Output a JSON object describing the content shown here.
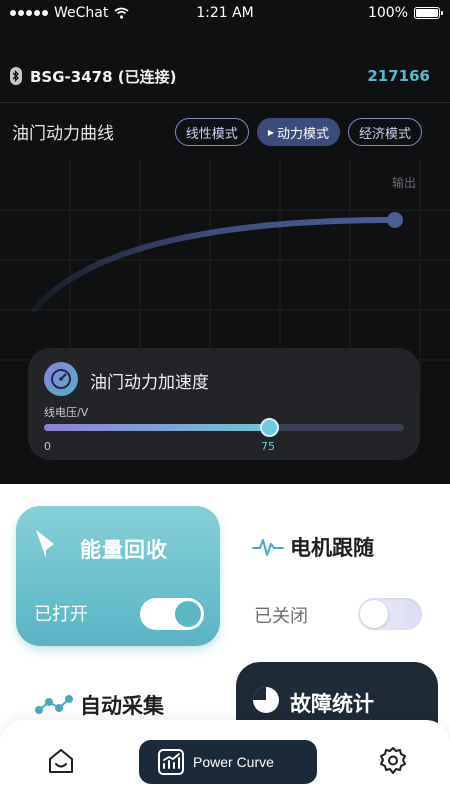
{
  "status_bar": {
    "carrier": "WeChat",
    "time": "1:21 AM",
    "battery": "100%"
  },
  "device": {
    "name": "BSG-3478 (已连接)",
    "code": "217166"
  },
  "curve": {
    "title": "油门动力曲线",
    "modes": [
      "线性模式",
      "动力模式",
      "经济模式"
    ],
    "active_mode": "动力模式",
    "output_label": "输出"
  },
  "acceleration": {
    "title": "油门动力加速度",
    "axis_label": "线电压/V",
    "min_label": "0",
    "value": 75,
    "value_label": "75"
  },
  "energy_recovery": {
    "title": "能量回收",
    "status": "已打开",
    "enabled": true
  },
  "motor_follow": {
    "title": "电机跟随",
    "status": "已关闭",
    "enabled": false
  },
  "auto_collect": {
    "title": "自动采集"
  },
  "fault_stats": {
    "title": "故障统计"
  },
  "nav": {
    "active_label": "Power Curve"
  },
  "colors": {
    "accent_teal": "#5ab8c6",
    "dark_navy": "#1b2a3a",
    "curve_blue": "#4a5d96"
  }
}
